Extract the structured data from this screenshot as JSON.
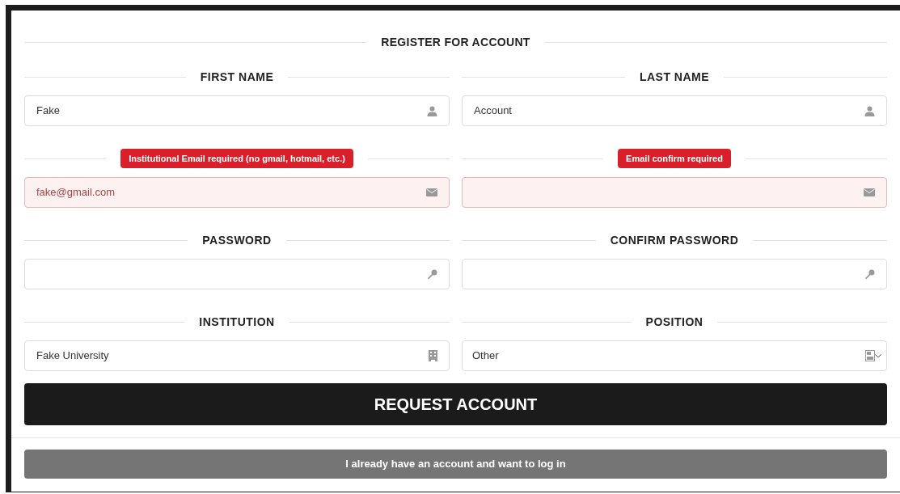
{
  "title": "REGISTER FOR ACCOUNT",
  "fields": [
    {
      "heading": {
        "kind": "label",
        "text": "FIRST NAME"
      },
      "kind": "name",
      "value": "Fake",
      "invalid": false
    },
    {
      "heading": {
        "kind": "label",
        "text": "LAST NAME"
      },
      "kind": "name",
      "value": "Account",
      "invalid": false
    },
    {
      "heading": {
        "kind": "error",
        "text": "Institutional Email required (no gmail, hotmail, etc.)"
      },
      "kind": "email",
      "value": "fake@gmail.com",
      "invalid": true
    },
    {
      "heading": {
        "kind": "error",
        "text": "Email confirm required"
      },
      "kind": "email",
      "invalid": true
    },
    {
      "heading": {
        "kind": "label",
        "text": "PASSWORD"
      },
      "kind": "password",
      "invalid": false
    },
    {
      "heading": {
        "kind": "label",
        "text": "CONFIRM PASSWORD"
      },
      "kind": "password",
      "invalid": false
    },
    {
      "heading": {
        "kind": "label",
        "text": "INSTITUTION"
      },
      "kind": "institution",
      "value": "Fake University",
      "invalid": false
    },
    {
      "heading": {
        "kind": "label",
        "text": "POSITION"
      },
      "kind": "position",
      "value": "Other",
      "invalid": false
    }
  ],
  "submit_button": "REQUEST ACCOUNT",
  "login_button": "I already have an account and want to log in"
}
